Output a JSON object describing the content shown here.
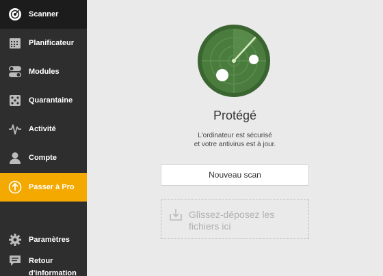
{
  "sidebar": {
    "items": [
      {
        "label": "Scanner",
        "icon": "radar-icon"
      },
      {
        "label": "Planificateur",
        "icon": "calendar-icon"
      },
      {
        "label": "Modules",
        "icon": "toggles-icon"
      },
      {
        "label": "Quarantaine",
        "icon": "dice-icon"
      },
      {
        "label": "Activité",
        "icon": "pulse-icon"
      },
      {
        "label": "Compte",
        "icon": "user-icon"
      },
      {
        "label": "Passer à Pro",
        "icon": "upgrade-arrow-icon"
      },
      {
        "label": "Paramètres",
        "icon": "gear-icon"
      },
      {
        "label": "Retour",
        "icon": "feedback-icon"
      },
      {
        "label": "d'information",
        "icon": ""
      }
    ],
    "active_item": "Scanner",
    "pro_color": "#f4a900"
  },
  "main": {
    "status_title": "Protégé",
    "status_line1": "L'ordinateur est sécurisé",
    "status_line2": "et votre antivirus est à jour.",
    "scan_button": "Nouveau scan",
    "drop_text": "Glissez-déposez les fichiers ici"
  },
  "colors": {
    "radar_green": "#4a7c3e",
    "radar_dark": "#3a6530",
    "sidebar_bg": "#2e2e2e",
    "accent": "#f4a900"
  }
}
